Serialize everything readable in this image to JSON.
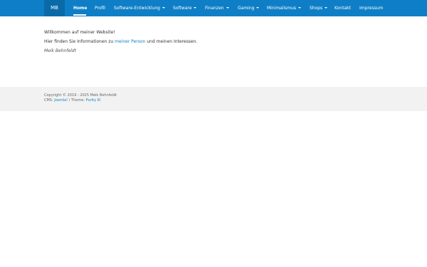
{
  "nav": {
    "brand": "MB",
    "items": [
      {
        "label": "Home"
      },
      {
        "label": "Profil"
      },
      {
        "label": "Software-Entwicklung"
      },
      {
        "label": "Software"
      },
      {
        "label": "Finanzen"
      },
      {
        "label": "Gaming"
      },
      {
        "label": "Minimalismus"
      },
      {
        "label": "Shops"
      },
      {
        "label": "Kontakt"
      },
      {
        "label": "Impressum"
      }
    ]
  },
  "content": {
    "welcome": "Willkommen auf meiner Website!",
    "intro_pre": "Hier finden Sie Informationen zu ",
    "intro_link": "meiner Person",
    "intro_post": " und meinen Interessen.",
    "signature": "Meik Behnfeldt"
  },
  "footer": {
    "copyright": "Copyright © 2019 - 2025 Meik Behnfeldt",
    "cms_label": "CMS: ",
    "cms_link": "Joomla!",
    "theme_label": " / Theme: ",
    "theme_link": "Purity III"
  },
  "colors": {
    "navbar": "#0e7fc6",
    "brand_bg": "#0a6aa8",
    "footer_bg": "#f2f2f2",
    "link": "#0e7fc6"
  }
}
